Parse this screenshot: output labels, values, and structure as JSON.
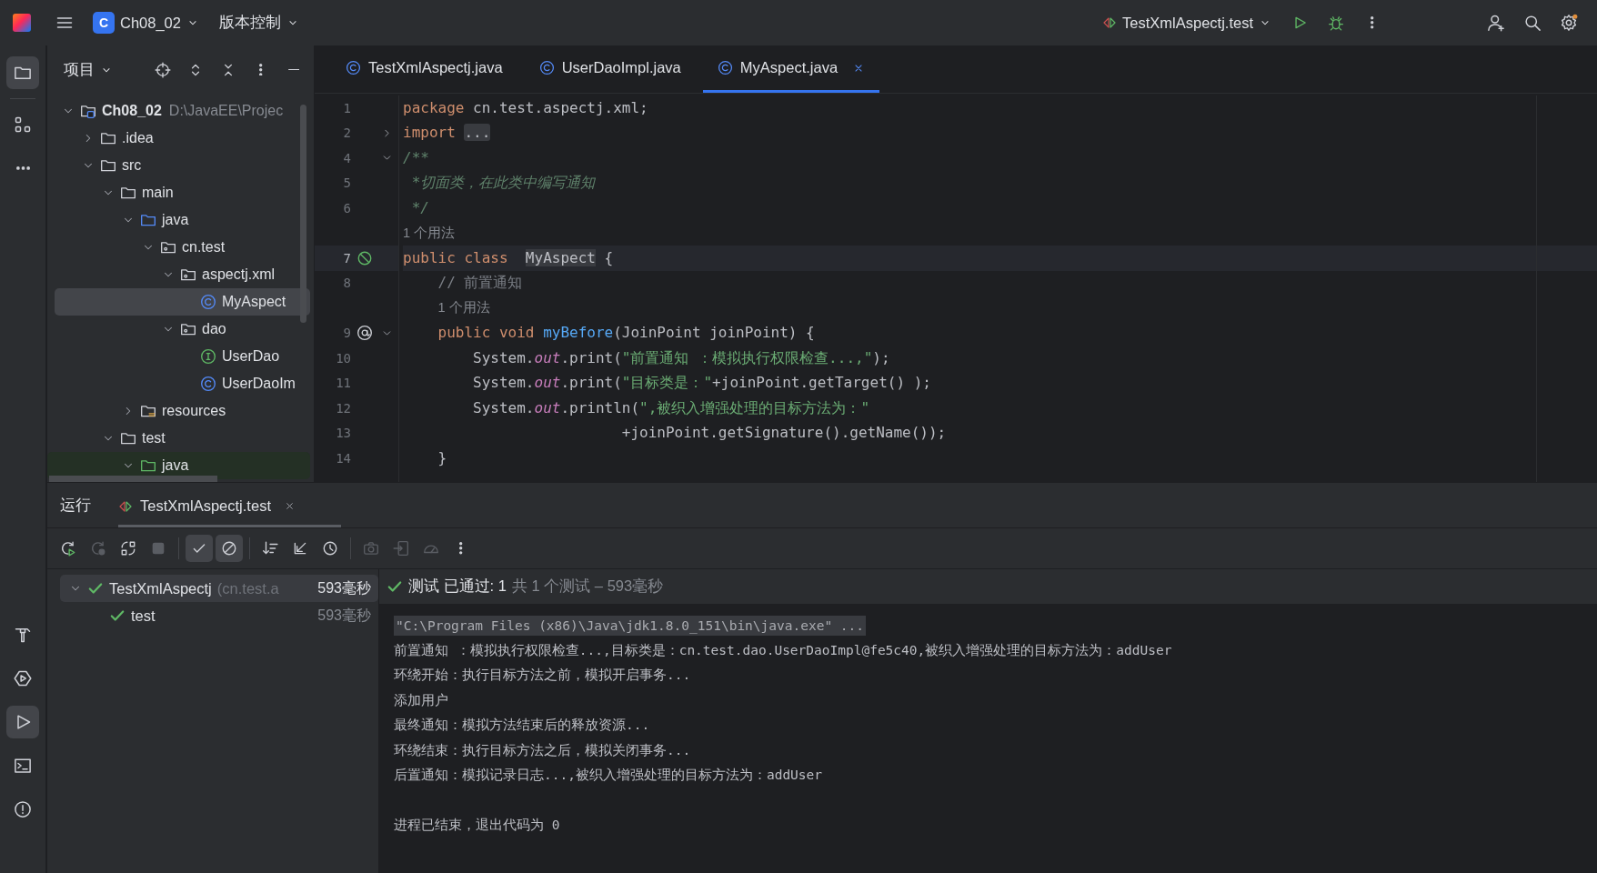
{
  "topbar": {
    "project_badge": "C",
    "project": "Ch08_02",
    "vcs": "版本控制",
    "run_config": "TestXmlAspectj.test"
  },
  "tool_strip": {
    "top": [
      {
        "kind": "project",
        "selected": true
      },
      {
        "kind": "structure",
        "selected": false
      },
      {
        "kind": "more",
        "selected": false
      }
    ],
    "bottom": [
      {
        "kind": "build",
        "selected": false
      },
      {
        "kind": "services",
        "selected": false
      },
      {
        "kind": "run",
        "selected": true
      },
      {
        "kind": "terminal",
        "selected": false
      },
      {
        "kind": "problems",
        "selected": false
      }
    ]
  },
  "project_panel": {
    "title": "项目",
    "tree": [
      {
        "kind": "project",
        "label": "Ch08_02",
        "path": "D:\\JavaEE\\Projec",
        "expanded": true,
        "selected": false,
        "children": [
          {
            "kind": "folder",
            "label": ".idea",
            "expanded": false,
            "selected": false
          },
          {
            "kind": "folder",
            "label": "src",
            "expanded": true,
            "selected": false,
            "children": [
              {
                "kind": "folder",
                "label": "main",
                "expanded": true,
                "selected": false,
                "children": [
                  {
                    "kind": "source-folder",
                    "label": "java",
                    "expanded": true,
                    "selected": false,
                    "children": [
                      {
                        "kind": "package",
                        "label": "cn.test",
                        "expanded": true,
                        "selected": false,
                        "children": [
                          {
                            "kind": "package",
                            "label": "aspectj.xml",
                            "expanded": true,
                            "selected": false,
                            "children": [
                              {
                                "kind": "class",
                                "label": "MyAspect",
                                "selected": true
                              }
                            ]
                          },
                          {
                            "kind": "package",
                            "label": "dao",
                            "expanded": true,
                            "selected": false,
                            "children": [
                              {
                                "kind": "interface",
                                "label": "UserDao",
                                "selected": false
                              },
                              {
                                "kind": "class",
                                "label": "UserDaoIm",
                                "selected": false
                              }
                            ]
                          }
                        ]
                      }
                    ]
                  },
                  {
                    "kind": "resources-folder",
                    "label": "resources",
                    "expanded": false,
                    "selected": false
                  }
                ]
              },
              {
                "kind": "folder",
                "label": "test",
                "expanded": true,
                "selected": false,
                "children": [
                  {
                    "kind": "test-folder",
                    "label": "java",
                    "expanded": true,
                    "selected": false
                  }
                ]
              }
            ]
          }
        ]
      }
    ]
  },
  "editor": {
    "tabs": [
      {
        "label": "TestXmlAspectj.java",
        "selected": false
      },
      {
        "label": "UserDaoImpl.java",
        "selected": false
      },
      {
        "label": "MyAspect.java",
        "selected": true
      }
    ],
    "lines": [
      {
        "kind": "code",
        "number": "1",
        "current": false,
        "tokens": [
          {
            "kind": "keyword",
            "text": "package"
          },
          {
            "kind": "plain",
            "text": " cn.test.aspectj.xml;"
          }
        ]
      },
      {
        "kind": "code",
        "number": "2",
        "fold": {
          "expanded": false
        },
        "current": false,
        "tokens": [
          {
            "kind": "keyword",
            "text": "import"
          },
          {
            "kind": "folded",
            "text": "..."
          }
        ]
      },
      {
        "kind": "code",
        "number": "4",
        "fold": {
          "expanded": true
        },
        "current": false,
        "tokens": [
          {
            "kind": "doc",
            "text": "/**"
          }
        ]
      },
      {
        "kind": "code",
        "number": "5",
        "current": false,
        "tokens": [
          {
            "kind": "doc",
            "text": " *切面类，在此类中编写通知"
          }
        ]
      },
      {
        "kind": "code",
        "number": "6",
        "current": false,
        "tokens": [
          {
            "kind": "doc",
            "text": " */"
          }
        ]
      },
      {
        "kind": "hint",
        "text": "1 个用法",
        "current": false
      },
      {
        "kind": "code",
        "number": "7",
        "gutter": {
          "kind": "implemented"
        },
        "current": true,
        "tokens": [
          {
            "kind": "keyword",
            "text": "public class "
          },
          {
            "kind": "highlight",
            "text": "MyAspect"
          },
          {
            "kind": "plain",
            "text": " {"
          }
        ]
      },
      {
        "kind": "code",
        "number": "8",
        "current": false,
        "tokens": [
          {
            "kind": "comment",
            "text": "    // 前置通知"
          }
        ]
      },
      {
        "kind": "hint",
        "text": "1 个用法",
        "current": false
      },
      {
        "kind": "code",
        "number": "9",
        "gutter": {
          "kind": "annotation"
        },
        "fold": {
          "expanded": true
        },
        "current": false,
        "tokens": [
          {
            "kind": "keyword",
            "text": "    public void "
          },
          {
            "kind": "method",
            "text": "myBefore"
          },
          {
            "kind": "plain",
            "text": "(JoinPoint joinPoint) {"
          }
        ]
      },
      {
        "kind": "code",
        "number": "10",
        "current": false,
        "tokens": [
          {
            "kind": "plain",
            "text": "        System."
          },
          {
            "kind": "field",
            "text": "out"
          },
          {
            "kind": "plain",
            "text": ".print("
          },
          {
            "kind": "string",
            "text": "\"前置通知 ：模拟执行权限检查...,\""
          },
          {
            "kind": "plain",
            "text": ");"
          }
        ]
      },
      {
        "kind": "code",
        "number": "11",
        "current": false,
        "tokens": [
          {
            "kind": "plain",
            "text": "        System."
          },
          {
            "kind": "field",
            "text": "out"
          },
          {
            "kind": "plain",
            "text": ".print("
          },
          {
            "kind": "string",
            "text": "\"目标类是：\""
          },
          {
            "kind": "plain",
            "text": "+joinPoint.getTarget() );"
          }
        ]
      },
      {
        "kind": "code",
        "number": "12",
        "current": false,
        "tokens": [
          {
            "kind": "plain",
            "text": "        System."
          },
          {
            "kind": "field",
            "text": "out"
          },
          {
            "kind": "plain",
            "text": ".println("
          },
          {
            "kind": "string",
            "text": "\",被织入增强处理的目标方法为：\""
          }
        ]
      },
      {
        "kind": "code",
        "number": "13",
        "current": false,
        "tokens": [
          {
            "kind": "plain",
            "text": "                         +joinPoint.getSignature().getName());"
          }
        ]
      },
      {
        "kind": "code",
        "number": "14",
        "current": false,
        "tokens": [
          {
            "kind": "plain",
            "text": "    }"
          }
        ]
      }
    ]
  },
  "run_panel": {
    "title": "运行",
    "tabs": [
      {
        "label": "TestXmlAspectj.test",
        "selected": true
      }
    ],
    "toolbar": [
      {
        "kind": "rerun",
        "on": false,
        "disabled": false
      },
      {
        "kind": "rerun-failed",
        "on": false,
        "disabled": true
      },
      {
        "kind": "auto-test",
        "on": false,
        "disabled": false
      },
      {
        "kind": "stop",
        "on": false,
        "disabled": true
      },
      {
        "kind": "show-passed",
        "on": true,
        "disabled": false
      },
      {
        "kind": "show-ignored",
        "on": true,
        "disabled": false
      },
      {
        "kind": "sort",
        "on": false,
        "disabled": false
      },
      {
        "kind": "import",
        "on": false,
        "disabled": false
      },
      {
        "kind": "history",
        "on": false,
        "disabled": false
      },
      {
        "kind": "snapshot",
        "on": false,
        "disabled": true
      },
      {
        "kind": "export",
        "on": false,
        "disabled": true
      },
      {
        "kind": "coverage",
        "on": false,
        "disabled": true
      },
      {
        "kind": "more",
        "on": false,
        "disabled": false
      }
    ],
    "tests": [
      {
        "name": "TestXmlAspectj",
        "detail": "(cn.test.a",
        "time": "593毫秒",
        "passed": true,
        "expanded": true,
        "selected": true,
        "children": [
          {
            "name": "test",
            "time": "593毫秒",
            "passed": true,
            "selected": false
          }
        ]
      }
    ],
    "summary": {
      "passed": true,
      "text": "测试 已通过: 1",
      "detail": "共 1 个测试 – 593毫秒"
    },
    "console": [
      {
        "kind": "command",
        "text": "\"C:\\Program Files (x86)\\Java\\jdk1.8.0_151\\bin\\java.exe\" ..."
      },
      {
        "kind": "output",
        "text": "前置通知 ：模拟执行权限检查...,目标类是：cn.test.dao.UserDaoImpl@fe5c40,被织入增强处理的目标方法为：addUser"
      },
      {
        "kind": "output",
        "text": "环绕开始：执行目标方法之前，模拟开启事务..."
      },
      {
        "kind": "output",
        "text": "添加用户"
      },
      {
        "kind": "output",
        "text": "最终通知：模拟方法结束后的释放资源..."
      },
      {
        "kind": "output",
        "text": "环绕结束：执行目标方法之后，模拟关闭事务..."
      },
      {
        "kind": "output",
        "text": "后置通知：模拟记录日志...,被织入增强处理的目标方法为：addUser"
      },
      {
        "kind": "exit",
        "text": "进程已结束，退出代码为 0"
      }
    ]
  }
}
